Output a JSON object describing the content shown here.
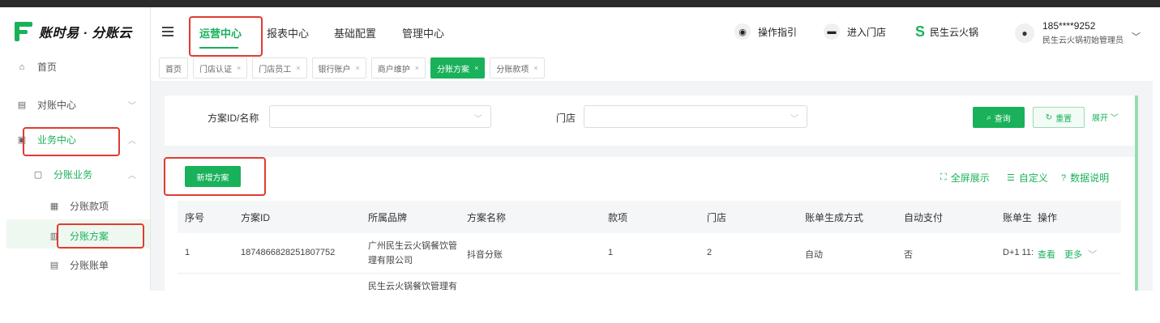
{
  "app": {
    "logo_text": "账时易 · 分账云",
    "brand_color": "#19b15a",
    "highlight_color": "#e03b33"
  },
  "sidebar": {
    "items": [
      {
        "label": "首页",
        "icon": "home-icon"
      },
      {
        "label": "对账中心",
        "icon": "reconcile-icon"
      },
      {
        "label": "业务中心",
        "icon": "business-icon"
      },
      {
        "label": "分账业务",
        "icon": "split-business-icon"
      },
      {
        "label": "分账款项",
        "icon": "split-item-icon"
      },
      {
        "label": "分账方案",
        "icon": "split-plan-icon"
      },
      {
        "label": "分账账单",
        "icon": "split-bill-icon"
      }
    ]
  },
  "header": {
    "nav": [
      "运营中心",
      "报表中心",
      "基础配置",
      "管理中心"
    ],
    "guide": "操作指引",
    "enter_store": "进入门店",
    "brand_name": "民生云火锅",
    "user_phone": "185****9252",
    "user_role": "民生云火锅初始管理员"
  },
  "tabs": [
    "首页",
    "门店认证",
    "门店员工",
    "银行账户",
    "商户维护",
    "分账方案",
    "分账款项"
  ],
  "filters": {
    "plan_label": "方案ID/名称",
    "store_label": "门店",
    "query": "查询",
    "reset": "重置",
    "expand": "展开"
  },
  "toolbar": {
    "add": "新增方案",
    "fullscreen": "全屏展示",
    "customize": "自定义",
    "data_desc": "数据说明"
  },
  "table": {
    "columns": [
      "序号",
      "方案ID",
      "所属品牌",
      "方案名称",
      "款项",
      "门店",
      "账单生成方式",
      "自动支付",
      "账单生",
      "操作"
    ],
    "rows": [
      {
        "index": "1",
        "id": "1874866828251807752",
        "brand": "广州民生云火锅餐饮管理有限公司",
        "name": "抖音分账",
        "items": "1",
        "stores": "2",
        "gen": "自动",
        "autopay": "否",
        "bill": "D+1 11:",
        "view": "查看",
        "more": "更多"
      },
      {
        "brand": "民生云火锅餐饮管理有"
      }
    ]
  }
}
